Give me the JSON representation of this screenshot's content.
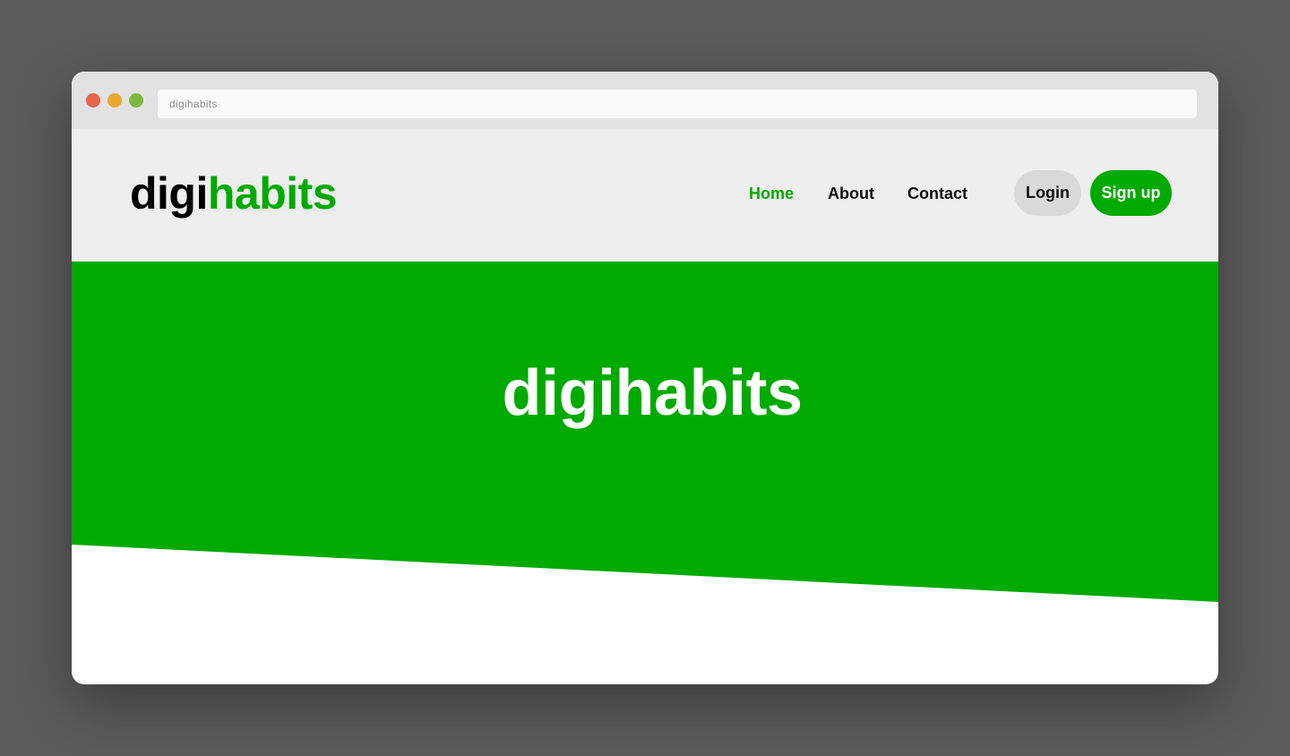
{
  "browser": {
    "address_text": "digihabits",
    "traffic_lights": {
      "close_color": "#e8664d",
      "minimize_color": "#e9a82e",
      "maximize_color": "#7cb83e"
    }
  },
  "header": {
    "logo": {
      "part1": "digi",
      "part2": "habits"
    },
    "nav": {
      "home": "Home",
      "about": "About",
      "contact": "Contact"
    },
    "login_label": "Login",
    "signup_label": "Sign up"
  },
  "hero": {
    "title": "digihabits"
  },
  "colors": {
    "brand_green": "#00aa00",
    "header_bg": "#eeeeee",
    "login_bg": "#d9d9d9"
  }
}
